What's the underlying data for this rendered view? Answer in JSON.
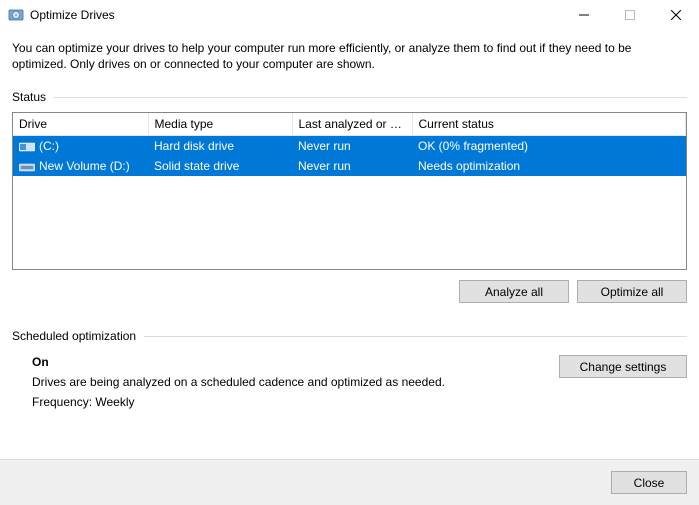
{
  "window": {
    "title": "Optimize Drives"
  },
  "description": "You can optimize your drives to help your computer run more efficiently, or analyze them to find out if they need to be optimized. Only drives on or connected to your computer are shown.",
  "status": {
    "label": "Status",
    "columns": {
      "drive": "Drive",
      "media_type": "Media type",
      "last_analyzed": "Last analyzed or o...",
      "current_status": "Current status"
    },
    "rows": [
      {
        "drive": "(C:)",
        "media_type": "Hard disk drive",
        "last_analyzed": "Never run",
        "current_status": "OK (0% fragmented)",
        "icon": "hdd"
      },
      {
        "drive": "New Volume (D:)",
        "media_type": "Solid state drive",
        "last_analyzed": "Never run",
        "current_status": "Needs optimization",
        "icon": "ssd"
      }
    ]
  },
  "buttons": {
    "analyze_all": "Analyze all",
    "optimize_all": "Optimize all",
    "change_settings": "Change settings",
    "close": "Close"
  },
  "scheduled": {
    "label": "Scheduled optimization",
    "state": "On",
    "description": "Drives are being analyzed on a scheduled cadence and optimized as needed.",
    "frequency": "Frequency: Weekly"
  }
}
